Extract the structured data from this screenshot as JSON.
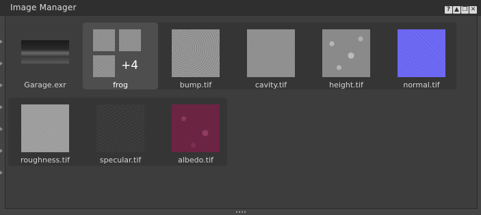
{
  "window": {
    "title": "Image Manager",
    "title_buttons": [
      {
        "name": "help",
        "glyph": "?"
      },
      {
        "name": "collapse",
        "glyph": "▲"
      },
      {
        "name": "float",
        "glyph": "❐"
      },
      {
        "name": "close",
        "glyph": "✕"
      }
    ]
  },
  "images": [
    {
      "label": "Garage.exr",
      "icon": "environment-thumbnail"
    },
    {
      "label": "frog",
      "icon": "group-thumbnail",
      "selected": true,
      "extra_count": "+4"
    },
    {
      "label": "bump.tif",
      "icon": "bump-thumbnail"
    },
    {
      "label": "cavity.tif",
      "icon": "cavity-thumbnail"
    },
    {
      "label": "height.tif",
      "icon": "height-thumbnail"
    },
    {
      "label": "normal.tif",
      "icon": "normal-thumbnail"
    },
    {
      "label": "roughness.tif",
      "icon": "roughness-thumbnail"
    },
    {
      "label": "specular.tif",
      "icon": "specular-thumbnail"
    },
    {
      "label": "albedo.tif",
      "icon": "albedo-thumbnail"
    }
  ],
  "colors": {
    "background": "#444444",
    "titlebar": "#2f2f2f",
    "group_background": "#353535",
    "selected_tile": "#4e4e4e",
    "normal_map": "#6f6af5",
    "albedo": "#6c2443"
  }
}
